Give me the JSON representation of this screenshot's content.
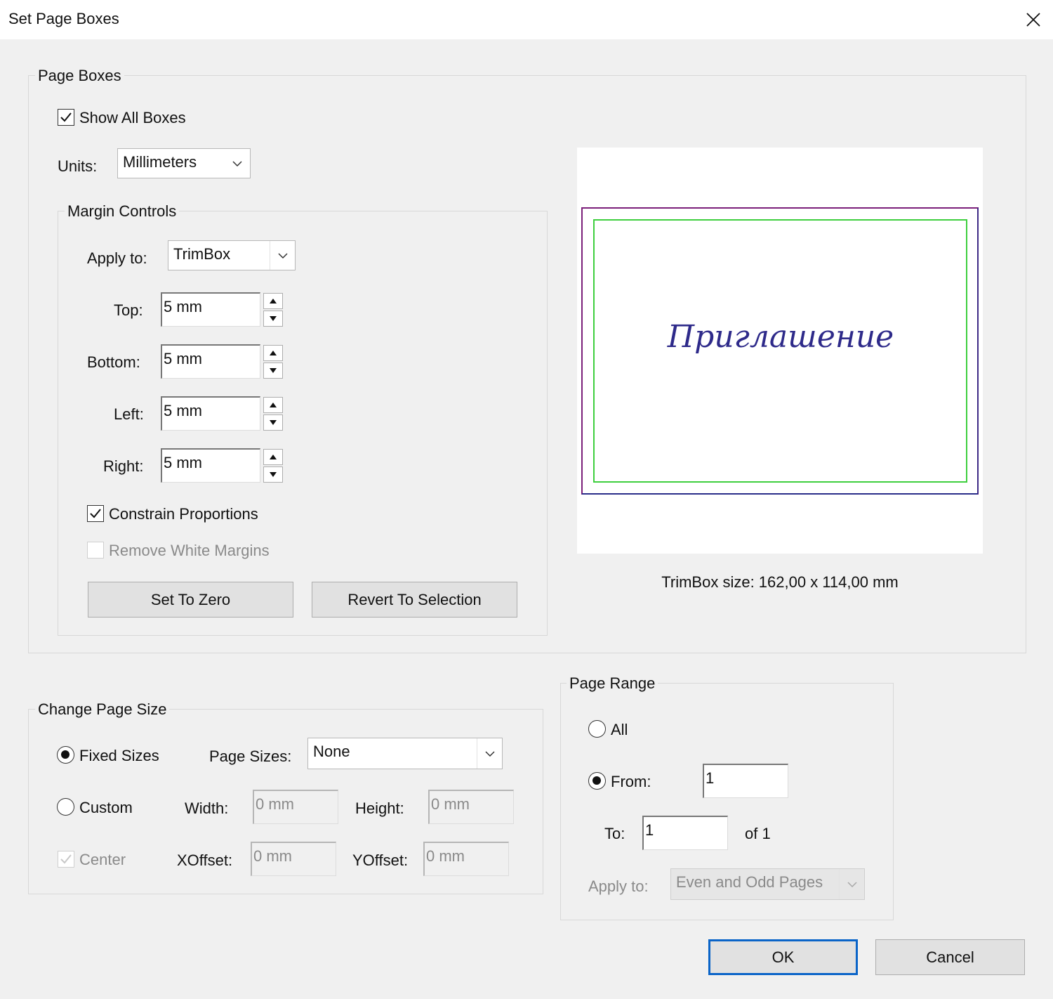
{
  "window": {
    "title": "Set Page Boxes"
  },
  "page_boxes": {
    "group_label": "Page Boxes",
    "show_all_boxes": {
      "label": "Show All Boxes",
      "checked": true
    },
    "units": {
      "label": "Units:",
      "value": "Millimeters"
    },
    "margin_controls": {
      "group_label": "Margin Controls",
      "apply_to": {
        "label": "Apply to:",
        "value": "TrimBox"
      },
      "top": {
        "label": "Top:",
        "value": "5 mm"
      },
      "bottom": {
        "label": "Bottom:",
        "value": "5 mm"
      },
      "left": {
        "label": "Left:",
        "value": "5 mm"
      },
      "right": {
        "label": "Right:",
        "value": "5 mm"
      },
      "constrain_proportions": {
        "label": "Constrain Proportions",
        "checked": true
      },
      "remove_white_margins": {
        "label": "Remove White Margins",
        "checked": false,
        "enabled": false
      },
      "set_to_zero": "Set To Zero",
      "revert_to_selection": "Revert To Selection"
    },
    "preview": {
      "page_text": "Приглашение",
      "trimbox_size": "TrimBox size: 162,00 x 114,00 mm",
      "colors": {
        "outer_box": "#7b1f7a",
        "outer_box_bottom": "#2a2d8a",
        "trim_box": "#3ecf3e",
        "text": "#2e2a8a"
      }
    }
  },
  "change_page_size": {
    "group_label": "Change Page Size",
    "fixed_sizes": {
      "label": "Fixed Sizes",
      "selected": true
    },
    "page_sizes": {
      "label": "Page Sizes:",
      "value": "None"
    },
    "custom": {
      "label": "Custom",
      "selected": false
    },
    "width": {
      "label": "Width:",
      "value": "0 mm"
    },
    "height": {
      "label": "Height:",
      "value": "0 mm"
    },
    "center": {
      "label": "Center",
      "checked": true,
      "enabled": false
    },
    "xoffset": {
      "label": "XOffset:",
      "value": "0 mm"
    },
    "yoffset": {
      "label": "YOffset:",
      "value": "0 mm"
    }
  },
  "page_range": {
    "group_label": "Page Range",
    "all": {
      "label": "All",
      "selected": false
    },
    "from": {
      "label": "From:",
      "value": "1",
      "selected": true
    },
    "to": {
      "label": "To:",
      "value": "1"
    },
    "of_total": "of 1",
    "apply_to": {
      "label": "Apply to:",
      "value": "Even and Odd Pages"
    }
  },
  "buttons": {
    "ok": "OK",
    "cancel": "Cancel"
  }
}
